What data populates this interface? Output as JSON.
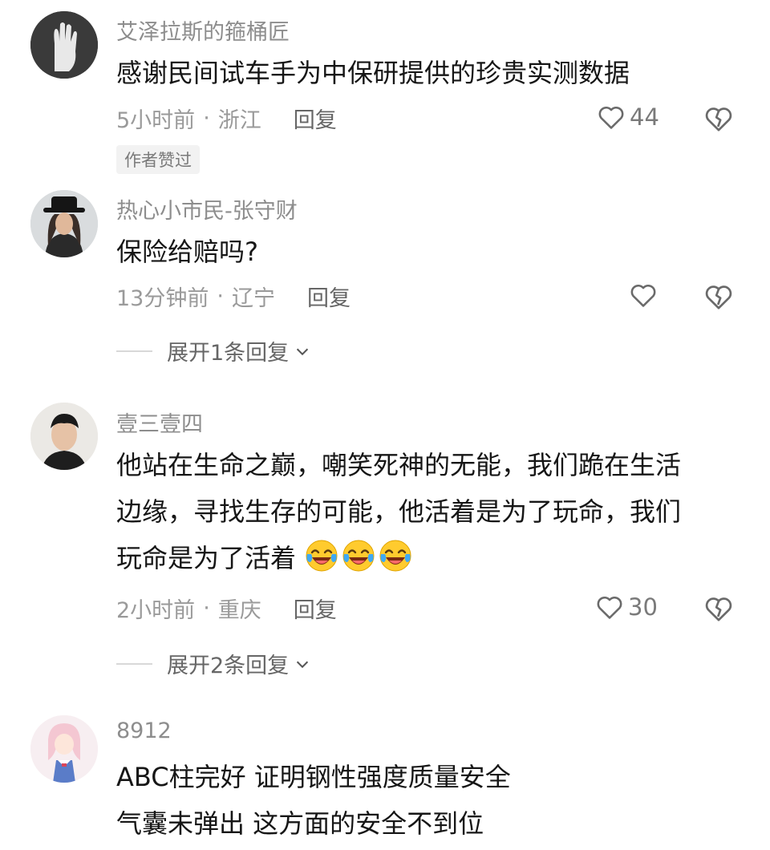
{
  "comments": [
    {
      "username": "艾泽拉斯的箍桶匠",
      "lines": [
        "感谢民间试车手为中保研提供的珍贵实测数据"
      ],
      "time": "5小时前",
      "separator": "·",
      "location": "浙江",
      "reply_label": "回复",
      "likes": "44",
      "badge": "作者赞过"
    },
    {
      "username": "热心小市民-张守财",
      "lines": [
        "保险给赔吗?"
      ],
      "time": "13分钟前",
      "separator": "·",
      "location": "辽宁",
      "reply_label": "回复",
      "likes": "",
      "expand_label": "展开1条回复"
    },
    {
      "username": "壹三壹四",
      "lines": [
        "他站在生命之巅，嘲笑死神的无能，我们跪在生活",
        "边缘，寻找生存的可能，他活着是为了玩命，我们",
        "玩命是为了活着"
      ],
      "emoji_count": 3,
      "time": "2小时前",
      "separator": "·",
      "location": "重庆",
      "reply_label": "回复",
      "likes": "30",
      "expand_label": "展开2条回复"
    },
    {
      "username": "8912",
      "lines": [
        "ABC柱完好 证明钢性强度质量安全",
        "气囊未弹出 这方面的安全不到位"
      ]
    }
  ],
  "icons": {
    "like": "heart-outline-icon",
    "dislike": "broken-heart-icon",
    "expand": "chevron-down-icon",
    "emoji": "laughing-crying-emoji-icon"
  },
  "colors": {
    "username": "#8d8d8d",
    "text": "#161616",
    "meta": "#9a9a9a",
    "badge_bg": "#f2f2f2"
  }
}
